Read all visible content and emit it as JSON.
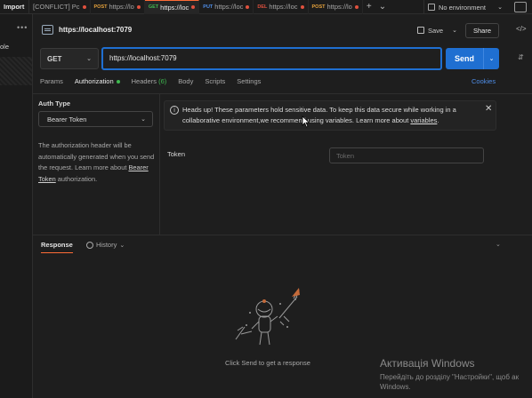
{
  "topbar": {
    "import_label": "Import",
    "tabs": [
      {
        "method": "",
        "label": "[CONFLICT] Pc",
        "modified": true,
        "active": false
      },
      {
        "method": "POST",
        "label": "https://lo",
        "modified": true,
        "active": false
      },
      {
        "method": "GET",
        "label": "https://loc",
        "modified": true,
        "active": true
      },
      {
        "method": "PUT",
        "label": "https://loc",
        "modified": true,
        "active": false
      },
      {
        "method": "DEL",
        "label": "https://loc",
        "modified": true,
        "active": false
      },
      {
        "method": "POST",
        "label": "https://lo",
        "modified": true,
        "active": false
      }
    ],
    "new_tab": "+",
    "more_tabs": "⌄",
    "environment": "No environment"
  },
  "sidebar": {
    "more": "•••",
    "label": "ole"
  },
  "request": {
    "title": "https://localhost:7079",
    "save_label": "Save",
    "share_label": "Share",
    "code_label": "</>",
    "method": "GET",
    "url": "https://localhost:7079",
    "send_label": "Send"
  },
  "subtabs": {
    "params": "Params",
    "authorization": "Authorization",
    "headers": "Headers",
    "headers_count": "(6)",
    "body": "Body",
    "scripts": "Scripts",
    "settings": "Settings",
    "cookies": "Cookies"
  },
  "auth": {
    "type_label": "Auth Type",
    "type_value": "Bearer Token",
    "desc_1": "The authorization header will be automatically generated when you send the request. Learn more about ",
    "desc_link": "Bearer Token",
    "desc_2": " authorization.",
    "banner_1": "Heads up! These parameters hold sensitive data. To keep this data secure while working in a collaborative environment,we recommend using variables. Learn more about ",
    "banner_link": "variables",
    "banner_2": ".",
    "token_label": "Token",
    "token_placeholder": "Token"
  },
  "response": {
    "label": "Response",
    "history_label": "History",
    "empty_text": "Click Send to get a response"
  },
  "watermark": {
    "title": "Активація Windows",
    "line1": "Перейдіть до розділу \"Настройки\", щоб ак",
    "line2": "Windows."
  },
  "colors": {
    "accent": "#1f6fd1",
    "tab_accent": "#ff6c37",
    "modified_dot": "#e0513e",
    "ok_green": "#3fb950",
    "link": "#4f8ee8"
  }
}
